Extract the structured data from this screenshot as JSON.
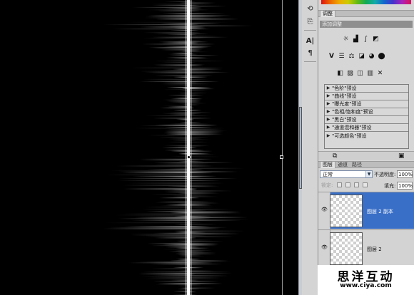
{
  "adjustments_panel": {
    "tab_label": "调整",
    "title": "添加调整",
    "presets": [
      "\"色阶\"预设",
      "\"曲线\"预设",
      "\"曝光度\"预设",
      "\"色相/饱和度\"预设",
      "\"黑白\"预设",
      "\"通道混和器\"预设",
      "\"可选颜色\"预设"
    ]
  },
  "layers_panel": {
    "tabs": [
      "图层",
      "通道",
      "路径"
    ],
    "blend_mode": "正常",
    "opacity_label": "不透明度:",
    "opacity_value": "100%",
    "lock_label": "锁定:",
    "fill_label": "填充:",
    "fill_value": "100%",
    "layers": [
      {
        "name": "图层 2 副本",
        "selected": true
      },
      {
        "name": "图层 2",
        "selected": false
      }
    ]
  },
  "dock": {
    "icons": [
      "history-icon",
      "clone-source-icon",
      "character-icon",
      "paragraph-icon"
    ]
  },
  "watermark": {
    "title": "思洋互动",
    "url": "www.ciya.com"
  }
}
